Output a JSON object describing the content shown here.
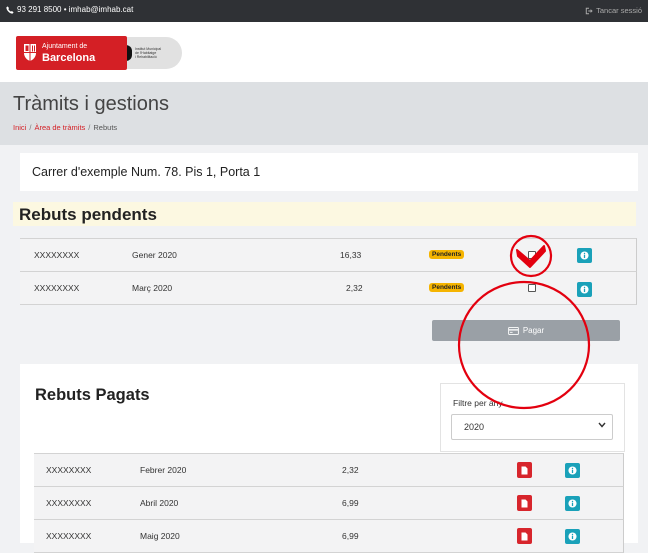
{
  "topbar": {
    "contact": "93 291 8500 • imhab@imhab.cat",
    "logout": "Tancar sessió"
  },
  "brand": {
    "ajuntament_line1": "Ajuntament de",
    "ajuntament_line2": "Barcelona",
    "imhab_text": [
      "Institut Municipal",
      "de l'Habitatge",
      "i Rehabilitació"
    ]
  },
  "page": {
    "title": "Tràmits i gestions",
    "breadcrumb": [
      "Inici",
      "Àrea de tràmits",
      "Rebuts"
    ]
  },
  "address": "Carrer d'exemple Num. 78. Pis 1, Porta 1",
  "pending": {
    "title": "Rebuts pendents",
    "rows": [
      {
        "id": "XXXXXXXX",
        "period": "Gener 2020",
        "amount": "16,33",
        "status": "Pendents",
        "selected": true
      },
      {
        "id": "XXXXXXXX",
        "period": "Març 2020",
        "amount": "2,32",
        "status": "Pendents",
        "selected": false
      }
    ],
    "pay_label": "Pagar"
  },
  "paid": {
    "title": "Rebuts Pagats",
    "filter_label": "Filtre per any",
    "filter_value": "2020",
    "rows": [
      {
        "id": "XXXXXXXX",
        "period": "Febrer 2020",
        "amount": "2,32"
      },
      {
        "id": "XXXXXXXX",
        "period": "Abril 2020",
        "amount": "6,99"
      },
      {
        "id": "XXXXXXXX",
        "period": "Maig 2020",
        "amount": "6,99"
      }
    ]
  },
  "colors": {
    "brand_red": "#d41f25",
    "badge_yellow": "#f5b400",
    "info_teal": "#1aa1b9",
    "annotation_red": "#e3000f"
  },
  "icons": [
    "phone-icon",
    "logout-icon",
    "barcelona-crest-icon",
    "info-icon",
    "pdf-icon",
    "wallet-icon",
    "chevron-down-icon"
  ]
}
